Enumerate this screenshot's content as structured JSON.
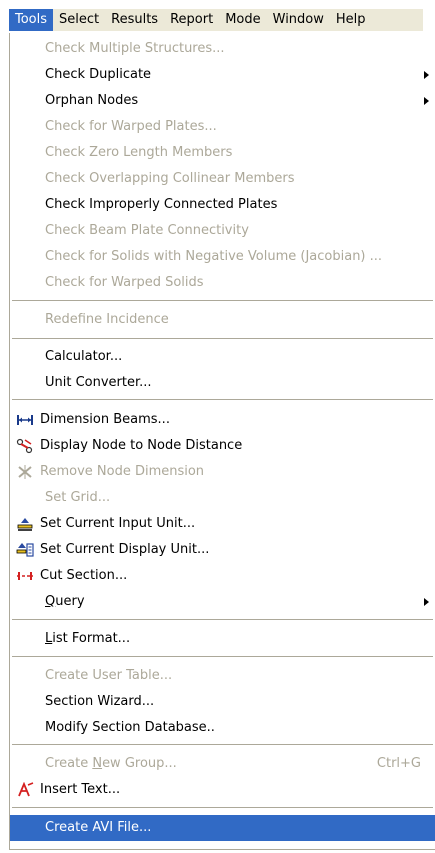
{
  "menubar": {
    "items": [
      "Tools",
      "Select",
      "Results",
      "Report",
      "Mode",
      "Window",
      "Help"
    ]
  },
  "menu": {
    "items": [
      {
        "label": "Check Multiple Structures...",
        "enabled": false
      },
      {
        "label": "Check Duplicate",
        "enabled": true,
        "submenu": true
      },
      {
        "label": "Orphan Nodes",
        "enabled": true,
        "submenu": true
      },
      {
        "label": "Check for Warped Plates...",
        "enabled": false
      },
      {
        "label": "Check Zero Length Members",
        "enabled": false
      },
      {
        "label": "Check Overlapping Collinear Members",
        "enabled": false
      },
      {
        "label": "Check Improperly Connected Plates",
        "enabled": true
      },
      {
        "label": "Check Beam Plate Connectivity",
        "enabled": false
      },
      {
        "label": "Check for Solids with Negative Volume (Jacobian) ...",
        "enabled": false
      },
      {
        "label": "Check for Warped Solids",
        "enabled": false
      },
      {
        "label": "Redefine Incidence",
        "enabled": false
      },
      {
        "label": "Calculator...",
        "enabled": true
      },
      {
        "label": "Unit Converter...",
        "enabled": true
      },
      {
        "label": "Dimension Beams...",
        "enabled": true,
        "icon": "dimension-beams-icon"
      },
      {
        "label": "Display Node to Node Distance",
        "enabled": true,
        "icon": "node-distance-icon"
      },
      {
        "label": "Remove Node Dimension",
        "enabled": false,
        "icon": "remove-node-dimension-icon"
      },
      {
        "label": "Set Grid...",
        "enabled": false
      },
      {
        "label": "Set Current Input Unit...",
        "enabled": true,
        "icon": "input-unit-icon"
      },
      {
        "label": "Set Current Display Unit...",
        "enabled": true,
        "icon": "display-unit-icon"
      },
      {
        "label": "Cut Section...",
        "enabled": true,
        "icon": "cut-section-icon"
      },
      {
        "label": "Query",
        "enabled": true,
        "submenu": true,
        "underline": "Q"
      },
      {
        "label": "List Format...",
        "enabled": true,
        "underline": "L"
      },
      {
        "label": "Create User Table...",
        "enabled": false
      },
      {
        "label": "Section Wizard...",
        "enabled": true
      },
      {
        "label": "Modify Section Database..",
        "enabled": true
      },
      {
        "label": "Create New Group...",
        "enabled": false,
        "shortcut": "Ctrl+G",
        "underline": "N"
      },
      {
        "label": "Insert Text...",
        "enabled": true,
        "icon": "insert-text-icon"
      },
      {
        "label": "Create AVI File...",
        "enabled": true,
        "highlighted": true
      }
    ]
  },
  "colors": {
    "highlight": "#316ac5",
    "disabled": "#aca899",
    "menubar_bg": "#ece9d8"
  }
}
